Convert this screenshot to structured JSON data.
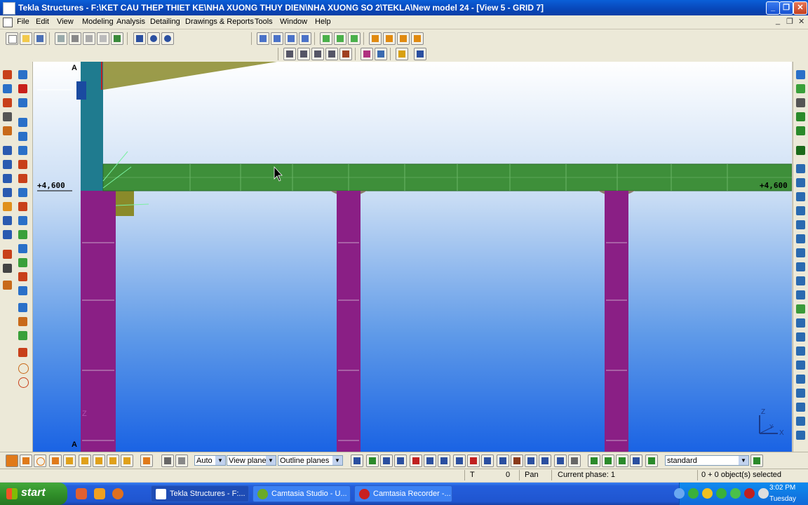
{
  "window": {
    "title": "Tekla Structures - F:\\KET CAU THEP THIET KE\\NHA XUONG THUY DIEN\\NHA XUONG SO 2\\TEKLA\\New model 24 - [View 5 - GRID 7]",
    "minimize_glyph": "_",
    "restore_glyph": "❐",
    "close_glyph": "✕"
  },
  "menu": {
    "items": [
      "File",
      "Edit",
      "View",
      "Modeling",
      "Analysis",
      "Detailing",
      "Drawings & Reports",
      "Tools",
      "Window",
      "Help"
    ],
    "mdi_min": "_",
    "mdi_restore": "❐",
    "mdi_close": "✕"
  },
  "viewport": {
    "grid_label_top": "A",
    "grid_label_bottom": "A",
    "level_left": "+4,600",
    "level_right": "+4,600",
    "axis_z": "Z",
    "axis_x": "X",
    "axis_y": "Y",
    "z_marker": "Z"
  },
  "bottom_toolbar": {
    "select_auto": "Auto",
    "select_view_plane": "View plane",
    "select_outline": "Outline planes",
    "select_standard": "standard"
  },
  "status": {
    "t_label": "T",
    "t_value": "0",
    "mode": "Pan",
    "phase": "Current phase: 1",
    "selected": "0 + 0 object(s) selected"
  },
  "taskbar": {
    "start": "start",
    "tasks": [
      "Tekla Structures - F:...",
      "Camtasia Studio - U...",
      "Camtasia Recorder -..."
    ],
    "time": "3:02 PM",
    "day": "Tuesday"
  },
  "colors": {
    "beam": "#3e8f3a",
    "column": "#8a1f85",
    "steel_blue": "#1f7b8f",
    "brace": "#8a8a2a"
  }
}
